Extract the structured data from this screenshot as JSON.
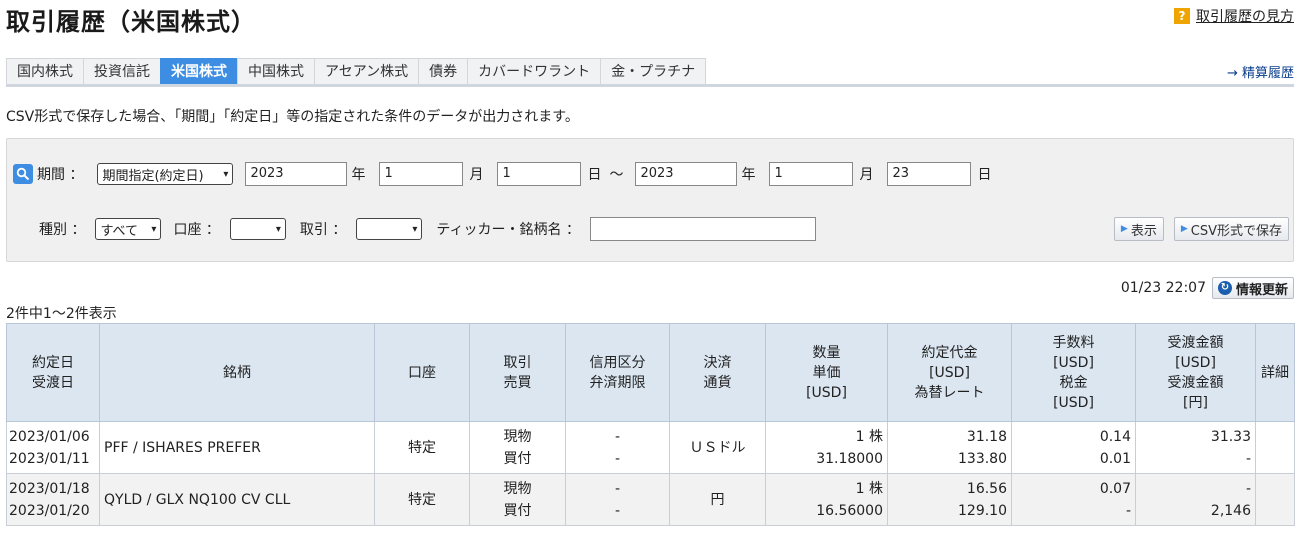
{
  "header": {
    "title": "取引履歴（米国株式）",
    "help_icon": "?",
    "help_link": "取引履歴の見方"
  },
  "tabs": [
    {
      "label": "国内株式",
      "active": false
    },
    {
      "label": "投資信託",
      "active": false
    },
    {
      "label": "米国株式",
      "active": true
    },
    {
      "label": "中国株式",
      "active": false
    },
    {
      "label": "アセアン株式",
      "active": false
    },
    {
      "label": "債券",
      "active": false
    },
    {
      "label": "カバードワラント",
      "active": false
    },
    {
      "label": "金・プラチナ",
      "active": false
    }
  ],
  "settlement_link": "→ 精算履歴",
  "note": "CSV形式で保存した場合、「期間」「約定日」等の指定された条件のデータが出力されます。",
  "search": {
    "period_label": "期間 ：",
    "period_type": "期間指定(約定日)",
    "from_year": "2023",
    "from_month": "1",
    "from_day": "1",
    "to_year": "2023",
    "to_month": "1",
    "to_day": "23",
    "year_unit": "年",
    "month_unit": "月",
    "day_unit": "日",
    "range_sep": "～",
    "type_label": "種別 ：",
    "type_value": "すべて",
    "account_label": "口座 ：",
    "account_value": "",
    "trade_label": "取引 ：",
    "trade_value": "",
    "ticker_label": "ティッカー・銘柄名 ：",
    "ticker_value": "",
    "display_button": "表示",
    "csv_button": "CSV形式で保存"
  },
  "update": {
    "timestamp": "01/23 22:07",
    "refresh_label": "情報更新"
  },
  "result_count": "2件中1～2件表示",
  "table": {
    "headers": {
      "date": [
        "約定日",
        "受渡日"
      ],
      "stock": [
        "銘柄"
      ],
      "account": [
        "口座"
      ],
      "trade": [
        "取引",
        "売買"
      ],
      "credit": [
        "信用区分",
        "弁済期限"
      ],
      "settle": [
        "決済",
        "通貨"
      ],
      "qty": [
        "数量",
        "単価",
        "[USD]"
      ],
      "amount": [
        "約定代金",
        "[USD]",
        "為替レート"
      ],
      "fee": [
        "手数料",
        "[USD]",
        "税金",
        "[USD]"
      ],
      "delivery": [
        "受渡金額",
        "[USD]",
        "受渡金額",
        "[円]"
      ],
      "detail": [
        "詳細"
      ]
    },
    "rows": [
      {
        "trade_date": "2023/01/06",
        "delivery_date": "2023/01/11",
        "stock": "PFF / ISHARES PREFER",
        "account": "特定",
        "trade_type": "現物",
        "side": "買付",
        "credit": "-",
        "due": "-",
        "currency": "ＵＳドル",
        "qty": "1 株",
        "price": "31.18000",
        "amount": "31.18",
        "fx_rate": "133.80",
        "fee": "0.14",
        "tax": "0.01",
        "delivery_usd": "31.33",
        "delivery_jpy": "-",
        "detail": ""
      },
      {
        "trade_date": "2023/01/18",
        "delivery_date": "2023/01/20",
        "stock": "QYLD / GLX NQ100 CV CLL",
        "account": "特定",
        "trade_type": "現物",
        "side": "買付",
        "credit": "-",
        "due": "-",
        "currency": "円",
        "qty": "1 株",
        "price": "16.56000",
        "amount": "16.56",
        "fx_rate": "129.10",
        "fee": "0.07",
        "tax": "-",
        "delivery_usd": "-",
        "delivery_jpy": "2,146",
        "detail": ""
      }
    ]
  },
  "colors": {
    "accent": "#3d8de2",
    "header_bg": "#dbe6f1",
    "help_icon": "#f0a400"
  }
}
